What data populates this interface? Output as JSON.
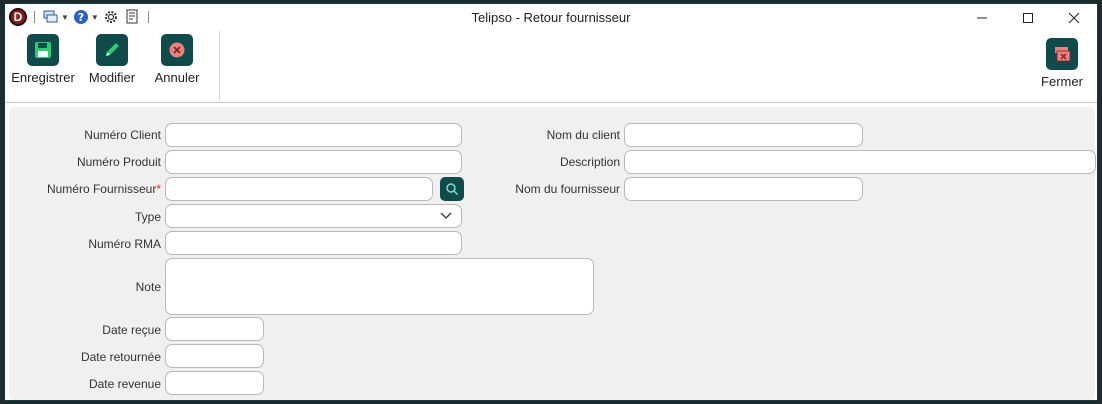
{
  "window": {
    "title": "Telipso - Retour fournisseur",
    "app_logo_letter": "D"
  },
  "quick_access": [
    {
      "icon": "windows-icon"
    },
    {
      "icon": "help-icon"
    },
    {
      "icon": "gear-icon"
    },
    {
      "icon": "report-icon"
    }
  ],
  "ribbon": {
    "save_label": "Enregistrer",
    "edit_label": "Modifier",
    "cancel_label": "Annuler",
    "close_label": "Fermer"
  },
  "form": {
    "client_number_label": "Numéro Client",
    "product_number_label": "Numéro Produit",
    "supplier_number_label": "Numéro Fournisseur",
    "required_mark": "*",
    "type_label": "Type",
    "rma_label": "Numéro RMA",
    "note_label": "Note",
    "date_received_label": "Date reçue",
    "date_returned_label": "Date retournée",
    "date_back_label": "Date revenue",
    "client_name_label": "Nom du client",
    "description_label": "Description",
    "supplier_name_label": "Nom du fournisseur",
    "values": {
      "client_number": "",
      "product_number": "",
      "supplier_number": "",
      "type": "",
      "rma": "",
      "note": "",
      "date_received": "",
      "date_returned": "",
      "date_back": "",
      "client_name": "",
      "description": "",
      "supplier_name": ""
    }
  },
  "colors": {
    "accent": "#0f4b4a",
    "required": "#c0392b",
    "panel_bg": "#f0f0f0"
  }
}
